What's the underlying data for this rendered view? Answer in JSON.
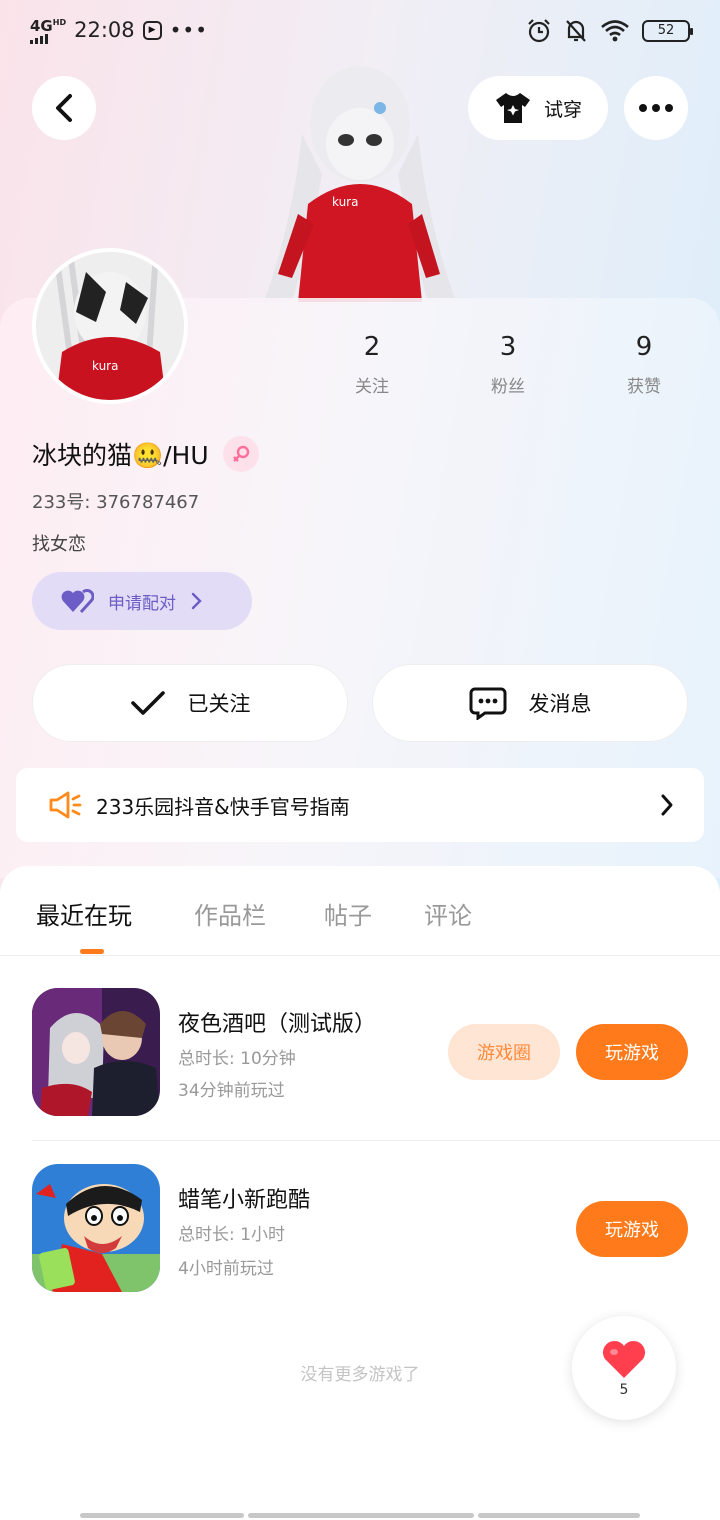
{
  "status_bar": {
    "network": "4G",
    "network_sup": "HD",
    "time": "22:08",
    "app_icon": "play-box-icon",
    "dots": "•••",
    "battery": "52"
  },
  "header": {
    "try_on_label": "试穿"
  },
  "profile": {
    "stats": [
      {
        "value": "2",
        "label": "关注"
      },
      {
        "value": "3",
        "label": "粉丝"
      },
      {
        "value": "9",
        "label": "获赞"
      }
    ],
    "nickname": "冰块的猫🤐/HU",
    "uid": "233号: 376787467",
    "bio": "找女恋",
    "pair_label": "申请配对",
    "follow_label": "已关注",
    "message_label": "发消息"
  },
  "notice": {
    "text": "233乐园抖音&快手官号指南"
  },
  "tabs": [
    "最近在玩",
    "作品栏",
    "帖子",
    "评论"
  ],
  "games": [
    {
      "name": "夜色酒吧（测试版）",
      "duration": "总时长: 10分钟",
      "last_played": "34分钟前玩过",
      "circle_label": "游戏圈",
      "play_label": "玩游戏"
    },
    {
      "name": "蜡笔小新跑酷",
      "duration": "总时长: 1小时",
      "last_played": "4小时前玩过",
      "play_label": "玩游戏"
    }
  ],
  "end_text": "没有更多游戏了",
  "like": {
    "count": "5"
  },
  "colors": {
    "accent": "#ff7a1a",
    "pair_bg": "#e2dcf6",
    "pair_text": "#6b5cc6"
  }
}
